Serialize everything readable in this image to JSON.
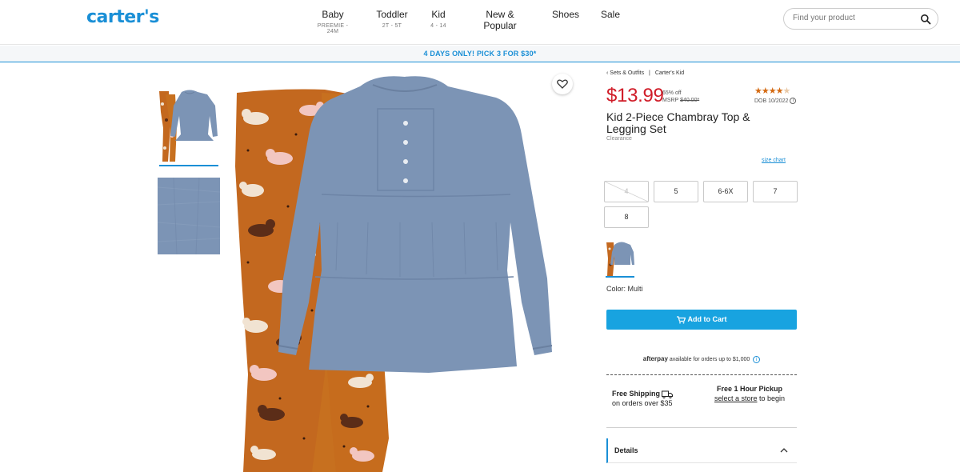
{
  "header": {
    "logo": "carter's",
    "nav": [
      {
        "label": "Baby",
        "sub": "PREEMIE - 24M"
      },
      {
        "label": "Toddler",
        "sub": "2T - 5T"
      },
      {
        "label": "Kid",
        "sub": "4 - 14"
      },
      {
        "label": "New & Popular",
        "sub": ""
      },
      {
        "label": "Shoes",
        "sub": ""
      },
      {
        "label": "Sale",
        "sub": ""
      }
    ],
    "search_placeholder": "Find your product"
  },
  "promo": "4 DAYS ONLY! PICK 3 FOR $30*",
  "breadcrumb": {
    "back": "‹ Sets & Outfits",
    "sep": "|",
    "brand": "Carter's Kid"
  },
  "product": {
    "price": "$13.99",
    "discount": "65% off",
    "msrp_label": "MSRP",
    "msrp": "$40.00*",
    "rating": 4.5,
    "rating_stars": "★★★★",
    "rating_half": "★",
    "dob": "DOB 10/2022",
    "title": "Kid 2-Piece Chambray Top & Legging Set",
    "status": "Clearance",
    "size_chart": "size chart",
    "sizes": [
      {
        "label": "4",
        "available": false
      },
      {
        "label": "5",
        "available": true
      },
      {
        "label": "6-6X",
        "available": true
      },
      {
        "label": "7",
        "available": true
      },
      {
        "label": "8",
        "available": true
      }
    ],
    "color_label": "Color: Multi",
    "add_to_cart": "Add to Cart"
  },
  "afterpay": {
    "brand": "afterpay",
    "text": "available for orders up to $1,000",
    "info": "i"
  },
  "shipping": {
    "title": "Free Shipping",
    "sub": "on orders over $35"
  },
  "pickup": {
    "title": "Free 1 Hour Pickup",
    "link": "select a store",
    "rest": "to begin"
  },
  "details_label": "Details",
  "colors": {
    "accent": "#1a8fd6",
    "price": "#d01c28",
    "cart_button": "#18a3e0",
    "star": "#d46a12",
    "chambray": "#7c94b5",
    "legging": "#c3681f"
  },
  "icons": [
    "search-icon",
    "heart-icon",
    "cart-icon",
    "truck-icon",
    "info-icon",
    "chevron-up-icon"
  ]
}
